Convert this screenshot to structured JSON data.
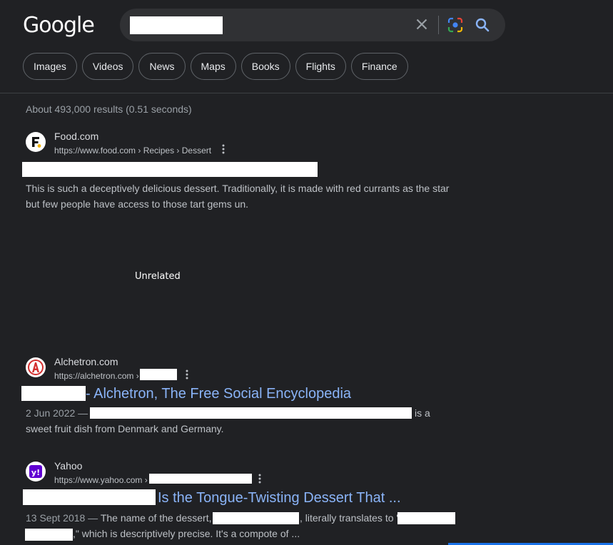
{
  "logo": {
    "text": "Google"
  },
  "chips": [
    "Images",
    "Videos",
    "News",
    "Maps",
    "Books",
    "Flights",
    "Finance"
  ],
  "stats": "About 493,000 results (0.51 seconds)",
  "results": [
    {
      "site": "Food.com",
      "url": "https://www.food.com › Recipes › Dessert",
      "snippet_line1": "This is such a deceptively delicious dessert. Traditionally, it is made with red currants as the star",
      "snippet_line2": "but few people have access to those tart gems un."
    },
    {
      "site": "Alchetron.com",
      "url": "https://alchetron.com ›",
      "title": "- Alchetron, The Free Social Encyclopedia",
      "date": "2 Jun 2022 —",
      "snippet_tail": "is a",
      "snippet_line2": "sweet fruit dish from Denmark and Germany."
    },
    {
      "site": "Yahoo",
      "url": "https://www.yahoo.com ›",
      "title": "Is the Tongue-Twisting Dessert That ...",
      "date": "13 Sept 2018 —",
      "snippet_a": "The name of the dessert,",
      "snippet_b": ", literally translates to \"",
      "snippet_c": ",\" which is descriptively precise. It's a compote of ..."
    }
  ],
  "overlay_label": "Unrelated",
  "colors": {
    "background": "#202124",
    "link": "#8ab4f8",
    "text": "#bdc1c6",
    "redaction": "#ffffff"
  },
  "icons": [
    "clear-icon",
    "lens-icon",
    "search-icon",
    "more-vert-icon"
  ]
}
